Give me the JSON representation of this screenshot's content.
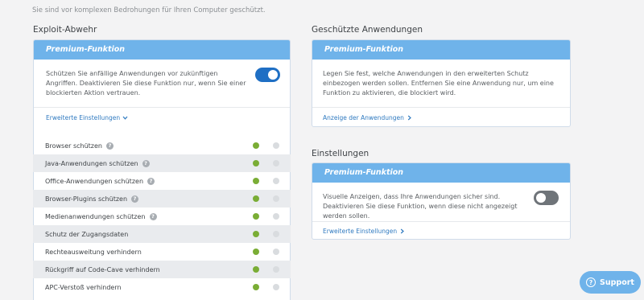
{
  "subtitle": "Sie sind vor komplexen Bedrohungen für Ihren Computer geschützt.",
  "exploit": {
    "title": "Exploit-Abwehr",
    "badge": "Premium-Funktion",
    "description": "Schützen Sie anfällige Anwendungen vor zukünftigen Angriffen. Deaktivieren Sie diese Funktion nur, wenn Sie einer blockierten Aktion vertrauen.",
    "toggle_on": true,
    "advanced_link": "Erweiterte Einstellungen",
    "rows": [
      {
        "label": "Browser schützen",
        "help": true
      },
      {
        "label": "Java-Anwendungen schützen",
        "help": true
      },
      {
        "label": "Office-Anwendungen schützen",
        "help": true
      },
      {
        "label": "Browser-Plugins schützen",
        "help": true
      },
      {
        "label": "Medienanwendungen schützen",
        "help": true
      },
      {
        "label": "Schutz der Zugangsdaten",
        "help": false
      },
      {
        "label": "Rechteausweitung verhindern",
        "help": false
      },
      {
        "label": "Rückgriff auf Code-Cave verhindern",
        "help": false
      },
      {
        "label": "APC-Verstoß verhindern",
        "help": false
      }
    ]
  },
  "protected_apps": {
    "title": "Geschützte Anwendungen",
    "badge": "Premium-Funktion",
    "description": "Legen Sie fest, welche Anwendungen in den erweiterten Schutz einbezogen werden sollen. Entfernen Sie eine Anwendung nur, um eine Funktion zu aktivieren, die blockiert wird.",
    "link": "Anzeige der Anwendungen"
  },
  "settings": {
    "title": "Einstellungen",
    "badge": "Premium-Funktion",
    "description": "Visuelle Anzeigen, dass Ihre Anwendungen sicher sind. Deaktivieren Sie diese Funktion, wenn diese nicht angezeigt werden sollen.",
    "toggle_on": false,
    "advanced_link": "Erweiterte Einstellungen"
  },
  "support": {
    "label": "Support",
    "icon": "question-icon"
  },
  "colors": {
    "accent": "#6fb3ea",
    "toggle_on": "#1f6fc4",
    "status_green": "#7aad35"
  }
}
